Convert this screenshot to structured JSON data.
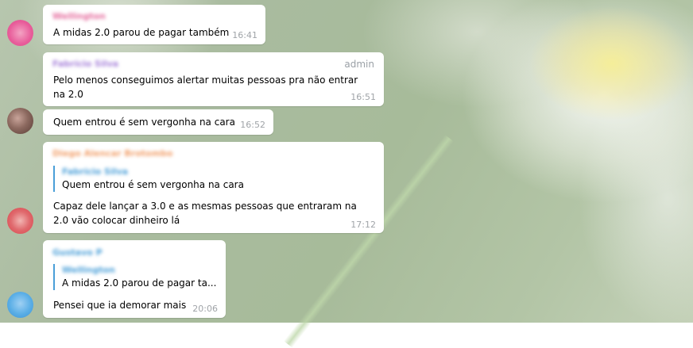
{
  "chat": {
    "messages": [
      {
        "sender": "Wellington",
        "sender_color": "#e56a9c",
        "text": "A midas 2.0 parou de pagar também",
        "time": "16:41",
        "avatar_color": "#e85c9a"
      },
      {
        "sender": "Fabrício Silva",
        "sender_color": "#a57fd9",
        "role": "admin",
        "text": "Pelo menos conseguimos alertar muitas pessoas pra não entrar na 2.0",
        "time": "16:51"
      },
      {
        "text": "Quem entrou é sem vergonha na cara",
        "time": "16:52",
        "avatar_color": "#7a5a54"
      },
      {
        "sender": "Diego Alencar Brotombo",
        "sender_color": "#f2a06b",
        "reply": {
          "name": "Fabrício Silva",
          "text": "Quem entrou é sem vergonha na cara"
        },
        "text": "Capaz dele lançar a 3.0 e as mesmas pessoas que entraram na 2.0 vão colocar dinheiro lá",
        "time": "17:12",
        "avatar_color": "#d9444a"
      },
      {
        "sender": "Gustavo P",
        "sender_color": "#4a9fd8",
        "reply": {
          "name": "Wellington",
          "text": "A midas 2.0 parou de pagar ta..."
        },
        "text": "Pensei que ia demorar mais",
        "time": "20:06",
        "avatar_color": "#4fa3e0"
      }
    ]
  }
}
